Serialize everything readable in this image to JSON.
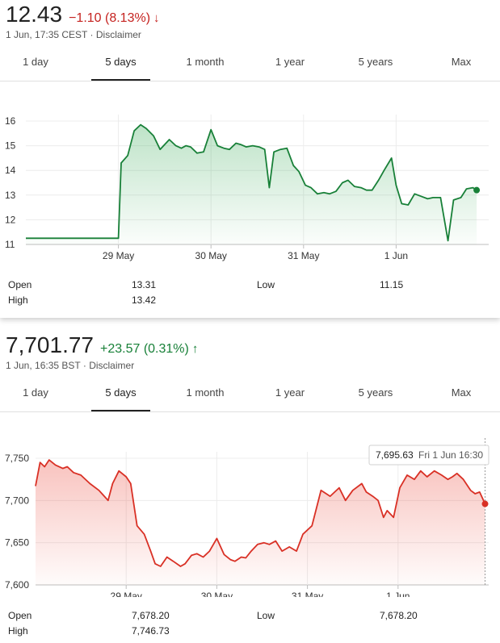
{
  "panel1": {
    "price": "12.43",
    "change": "−1.10 (8.13%)",
    "change_direction": "down",
    "arrow_icon": "arrow-down-icon",
    "timestamp": "1 Jun, 17:35 CEST",
    "disclaimer": "Disclaimer",
    "tabs": [
      "1 day",
      "5 days",
      "1 month",
      "1 year",
      "5 years",
      "Max"
    ],
    "active_tab": "5 days",
    "stats": {
      "open_label": "Open",
      "open_value": "13.31",
      "high_label": "High",
      "high_value": "13.42",
      "low_label": "Low",
      "low_value": "11.15"
    },
    "line_color": "#188038",
    "fill_color": "#34a853"
  },
  "panel2": {
    "price": "7,701.77",
    "change": "+23.57 (0.31%)",
    "change_direction": "up",
    "arrow_icon": "arrow-up-icon",
    "timestamp": "1 Jun, 16:35 BST",
    "disclaimer": "Disclaimer",
    "tabs": [
      "1 day",
      "5 days",
      "1 month",
      "1 year",
      "5 years",
      "Max"
    ],
    "active_tab": "5 days",
    "tooltip_value": "7,695.63",
    "tooltip_time": "Fri 1 Jun 16:30",
    "stats": {
      "open_label": "Open",
      "open_value": "7,678.20",
      "high_label": "High",
      "high_value": "7,746.73",
      "low_label": "Low",
      "low_value": "7,678.20"
    },
    "line_color": "#d93025",
    "fill_color": "#ea4335"
  },
  "chart_data": [
    {
      "type": "area",
      "ylim": [
        11,
        16
      ],
      "yticks": [
        11,
        12,
        13,
        14,
        15,
        16
      ],
      "xticks": [
        {
          "label": "29 May",
          "t": 1
        },
        {
          "label": "30 May",
          "t": 2
        },
        {
          "label": "31 May",
          "t": 3
        },
        {
          "label": "1 Jun",
          "t": 4
        }
      ],
      "xlim": [
        0,
        5
      ],
      "grid": true,
      "series": [
        {
          "x": [
            0,
            0.48,
            1.0,
            1.03,
            1.1,
            1.17,
            1.24,
            1.3,
            1.38,
            1.45,
            1.5,
            1.55,
            1.62,
            1.68,
            1.73,
            1.78,
            1.85,
            1.92,
            2.0,
            2.07,
            2.14,
            2.2,
            2.27,
            2.32,
            2.38,
            2.45,
            2.52,
            2.58,
            2.63,
            2.68,
            2.75,
            2.82,
            2.89,
            2.95,
            3.02,
            3.08,
            3.15,
            3.22,
            3.28,
            3.35,
            3.42,
            3.48,
            3.55,
            3.62,
            3.68,
            3.74,
            3.81,
            3.87,
            3.95,
            4.0,
            4.06,
            4.13,
            4.2,
            4.27,
            4.34,
            4.4,
            4.48,
            4.56,
            4.62,
            4.7,
            4.76,
            4.83,
            4.87
          ],
          "values": [
            11.25,
            11.25,
            11.25,
            14.3,
            14.6,
            15.6,
            15.85,
            15.7,
            15.4,
            14.85,
            15.05,
            15.25,
            15.0,
            14.9,
            15.0,
            14.95,
            14.7,
            14.75,
            15.65,
            15.0,
            14.9,
            14.85,
            15.1,
            15.05,
            14.95,
            15.0,
            14.95,
            14.85,
            13.3,
            14.75,
            14.85,
            14.9,
            14.2,
            13.95,
            13.4,
            13.3,
            13.05,
            13.1,
            13.05,
            13.15,
            13.5,
            13.6,
            13.35,
            13.3,
            13.2,
            13.2,
            13.6,
            14.0,
            14.5,
            13.4,
            12.65,
            12.6,
            13.05,
            12.95,
            12.85,
            12.9,
            12.9,
            11.15,
            12.8,
            12.9,
            13.25,
            13.3,
            13.2
          ]
        }
      ]
    },
    {
      "type": "area",
      "ylim": [
        7600,
        7750
      ],
      "yticks": [
        7600,
        7650,
        7700,
        7750
      ],
      "xticks": [
        {
          "label": "29 May",
          "t": 1
        },
        {
          "label": "30 May",
          "t": 2
        },
        {
          "label": "31 May",
          "t": 3
        },
        {
          "label": "1 Jun",
          "t": 4
        }
      ],
      "xlim": [
        0,
        5
      ],
      "grid": true,
      "series": [
        {
          "x": [
            0,
            0.05,
            0.1,
            0.15,
            0.22,
            0.3,
            0.35,
            0.42,
            0.5,
            0.6,
            0.7,
            0.8,
            0.85,
            0.92,
            1.0,
            1.05,
            1.12,
            1.2,
            1.27,
            1.32,
            1.38,
            1.45,
            1.52,
            1.6,
            1.65,
            1.72,
            1.78,
            1.85,
            1.92,
            2.0,
            2.08,
            2.15,
            2.2,
            2.27,
            2.32,
            2.38,
            2.45,
            2.52,
            2.58,
            2.65,
            2.72,
            2.8,
            2.88,
            2.95,
            3.05,
            3.15,
            3.25,
            3.35,
            3.42,
            3.5,
            3.6,
            3.65,
            3.72,
            3.78,
            3.84,
            3.88,
            3.95,
            4.02,
            4.1,
            4.18,
            4.25,
            4.32,
            4.4,
            4.48,
            4.55,
            4.6,
            4.65,
            4.72,
            4.8,
            4.85,
            4.9,
            4.96
          ],
          "values": [
            7717,
            7745,
            7740,
            7748,
            7742,
            7738,
            7740,
            7733,
            7730,
            7720,
            7712,
            7700,
            7720,
            7735,
            7728,
            7720,
            7670,
            7660,
            7640,
            7625,
            7622,
            7633,
            7628,
            7622,
            7625,
            7635,
            7637,
            7633,
            7640,
            7655,
            7636,
            7630,
            7628,
            7633,
            7632,
            7640,
            7648,
            7650,
            7648,
            7652,
            7640,
            7645,
            7640,
            7660,
            7670,
            7712,
            7705,
            7715,
            7700,
            7712,
            7720,
            7710,
            7705,
            7700,
            7680,
            7688,
            7680,
            7715,
            7730,
            7725,
            7735,
            7728,
            7735,
            7730,
            7725,
            7728,
            7732,
            7725,
            7712,
            7708,
            7710,
            7696
          ]
        }
      ]
    }
  ]
}
